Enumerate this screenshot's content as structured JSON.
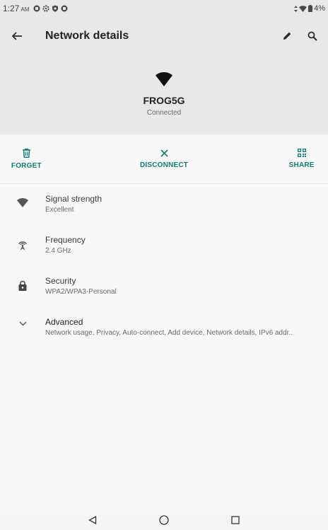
{
  "status_bar": {
    "time": "1:27",
    "ampm": "AM",
    "battery": "4%"
  },
  "app_bar": {
    "title": "Network details"
  },
  "network": {
    "name": "FROG5G",
    "status": "Connected"
  },
  "actions": [
    {
      "label": "FORGET",
      "icon": "delete-icon"
    },
    {
      "label": "DISCONNECT",
      "icon": "close-icon"
    },
    {
      "label": "SHARE",
      "icon": "qr-code-icon"
    }
  ],
  "details": [
    {
      "title": "Signal strength",
      "value": "Excellent",
      "icon": "wifi-signal-icon"
    },
    {
      "title": "Frequency",
      "value": "2.4 GHz",
      "icon": "antenna-icon"
    },
    {
      "title": "Security",
      "value": "WPA2/WPA3-Personal",
      "icon": "lock-icon"
    },
    {
      "title": "Advanced",
      "value": "Network usage, Privacy, Auto-connect, Add device, Network details, IPv6 addr..",
      "icon": "chevron-down-icon"
    }
  ],
  "colors": {
    "accent": "#0f7e72",
    "header_bg": "#e8e8e8",
    "page_bg": "#f8f8f8"
  }
}
